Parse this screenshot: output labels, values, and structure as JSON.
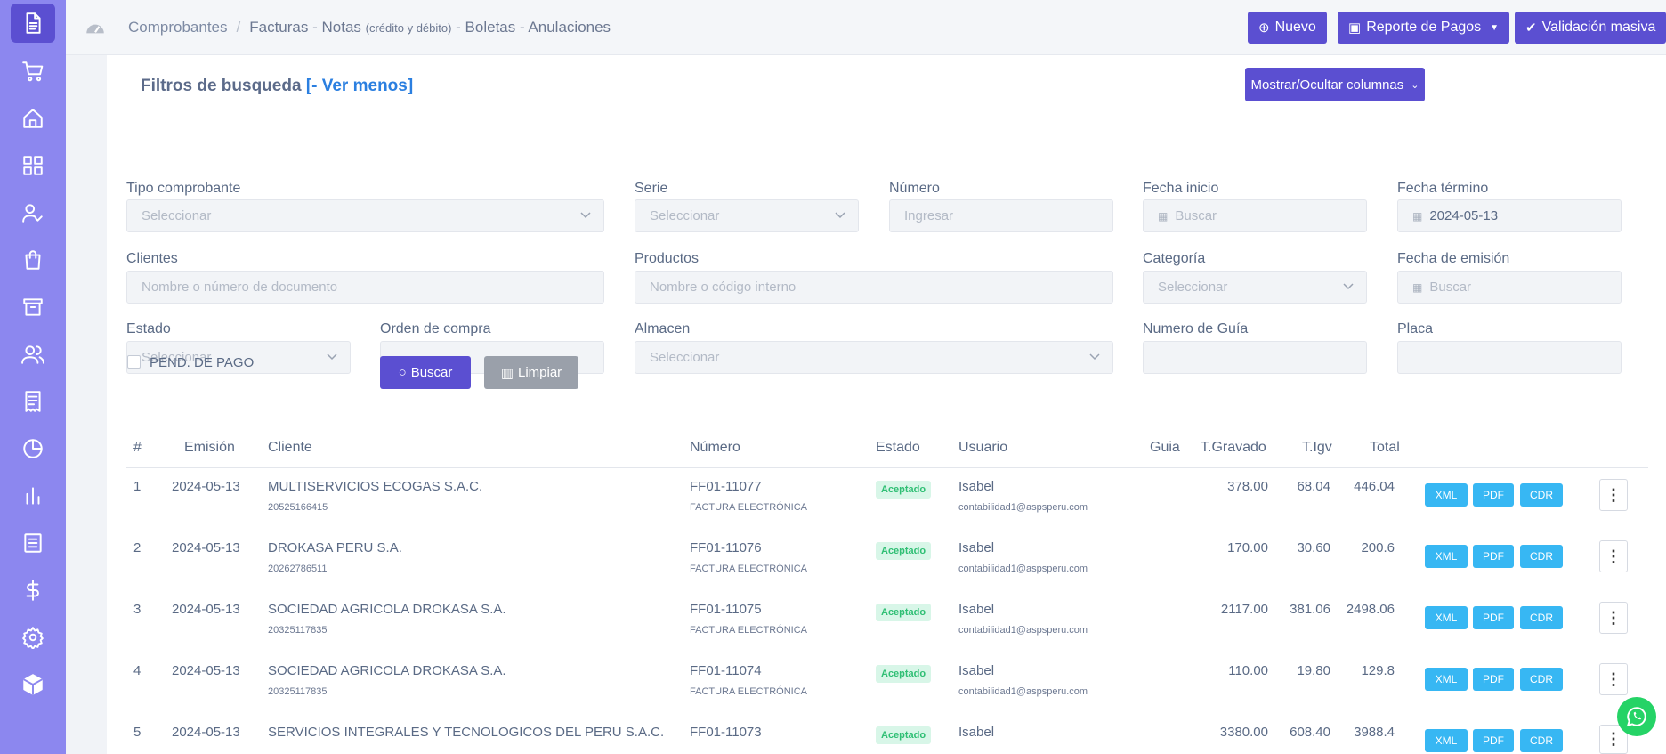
{
  "sidebar": {
    "items": [
      {
        "icon": "document-icon"
      },
      {
        "icon": "cart-icon"
      },
      {
        "icon": "home-icon"
      },
      {
        "icon": "grid-icon"
      },
      {
        "icon": "user-check-icon"
      },
      {
        "icon": "bag-icon"
      },
      {
        "icon": "archive-icon"
      },
      {
        "icon": "users-icon"
      },
      {
        "icon": "receipt-icon"
      },
      {
        "icon": "pie-chart-icon"
      },
      {
        "icon": "bar-chart-icon"
      },
      {
        "icon": "list-icon"
      },
      {
        "icon": "dollar-icon"
      },
      {
        "icon": "settings-icon"
      },
      {
        "icon": "box-icon"
      }
    ]
  },
  "header": {
    "breadcrumb_root": "Comprobantes",
    "breadcrumb_part1": "Facturas - Notas ",
    "breadcrumb_small": "(crédito y débito)",
    "breadcrumb_part2": " - Boletas - Anulaciones",
    "btn_nuevo": "Nuevo",
    "btn_reporte": "Reporte de Pagos",
    "btn_validacion": "Validación masiva"
  },
  "filters": {
    "title": "Filtros de busqueda",
    "toggle_link": "[- Ver menos]",
    "columns_button": "Mostrar/Ocultar columnas",
    "tipo_label": "Tipo comprobante",
    "tipo_placeholder": "Seleccionar",
    "serie_label": "Serie",
    "serie_placeholder": "Seleccionar",
    "numero_label": "Número",
    "numero_placeholder": "Ingresar",
    "fecha_inicio_label": "Fecha inicio",
    "fecha_inicio_placeholder": "Buscar",
    "fecha_termino_label": "Fecha término",
    "fecha_termino_value": "2024-05-13",
    "clientes_label": "Clientes",
    "clientes_placeholder": "Nombre o número de documento",
    "productos_label": "Productos",
    "productos_placeholder": "Nombre o código interno",
    "categoria_label": "Categoría",
    "categoria_placeholder": "Seleccionar",
    "fecha_emision_label": "Fecha de emisión",
    "fecha_emision_placeholder": "Buscar",
    "estado_label": "Estado",
    "estado_placeholder": "Seleccionar",
    "orden_label": "Orden de compra",
    "almacen_label": "Almacen",
    "almacen_placeholder": "Seleccionar",
    "guia_label": "Numero de Guía",
    "placa_label": "Placa",
    "pend_pago_label": "PEND. DE PAGO",
    "btn_buscar": "Buscar",
    "btn_limpiar": "Limpiar"
  },
  "table": {
    "headers": {
      "num": "#",
      "emision": "Emisión",
      "cliente": "Cliente",
      "numero": "Número",
      "estado": "Estado",
      "usuario": "Usuario",
      "guia": "Guia",
      "gravado": "T.Gravado",
      "igv": "T.Igv",
      "total": "Total"
    },
    "actions": {
      "xml": "XML",
      "pdf": "PDF",
      "cdr": "CDR",
      "more": "⋮"
    },
    "rows": [
      {
        "num": "1",
        "emision": "2024-05-13",
        "cliente": "MULTISERVICIOS ECOGAS S.A.C.",
        "ruc": "20525166415",
        "numero": "FF01-11077",
        "tipo": "FACTURA ELECTRÓNICA",
        "estado": "Aceptado",
        "usuario": "Isabel",
        "email": "contabilidad1@aspsperu.com",
        "gravado": "378.00",
        "igv": "68.04",
        "total": "446.04"
      },
      {
        "num": "2",
        "emision": "2024-05-13",
        "cliente": "DROKASA PERU S.A.",
        "ruc": "20262786511",
        "numero": "FF01-11076",
        "tipo": "FACTURA ELECTRÓNICA",
        "estado": "Aceptado",
        "usuario": "Isabel",
        "email": "contabilidad1@aspsperu.com",
        "gravado": "170.00",
        "igv": "30.60",
        "total": "200.6"
      },
      {
        "num": "3",
        "emision": "2024-05-13",
        "cliente": "SOCIEDAD AGRICOLA DROKASA S.A.",
        "ruc": "20325117835",
        "numero": "FF01-11075",
        "tipo": "FACTURA ELECTRÓNICA",
        "estado": "Aceptado",
        "usuario": "Isabel",
        "email": "contabilidad1@aspsperu.com",
        "gravado": "2117.00",
        "igv": "381.06",
        "total": "2498.06"
      },
      {
        "num": "4",
        "emision": "2024-05-13",
        "cliente": "SOCIEDAD AGRICOLA DROKASA S.A.",
        "ruc": "20325117835",
        "numero": "FF01-11074",
        "tipo": "FACTURA ELECTRÓNICA",
        "estado": "Aceptado",
        "usuario": "Isabel",
        "email": "contabilidad1@aspsperu.com",
        "gravado": "110.00",
        "igv": "19.80",
        "total": "129.8"
      },
      {
        "num": "5",
        "emision": "2024-05-13",
        "cliente": "SERVICIOS INTEGRALES Y TECNOLOGICOS DEL PERU S.A.C.",
        "ruc": "",
        "numero": "FF01-11073",
        "tipo": "",
        "estado": "Aceptado",
        "usuario": "Isabel",
        "email": "",
        "gravado": "3380.00",
        "igv": "608.40",
        "total": "3988.4"
      }
    ]
  },
  "colors": {
    "sidebar": "#8c87ef",
    "primary": "#5b4fd1",
    "info": "#37b7f3",
    "success": "#2fbf74"
  }
}
